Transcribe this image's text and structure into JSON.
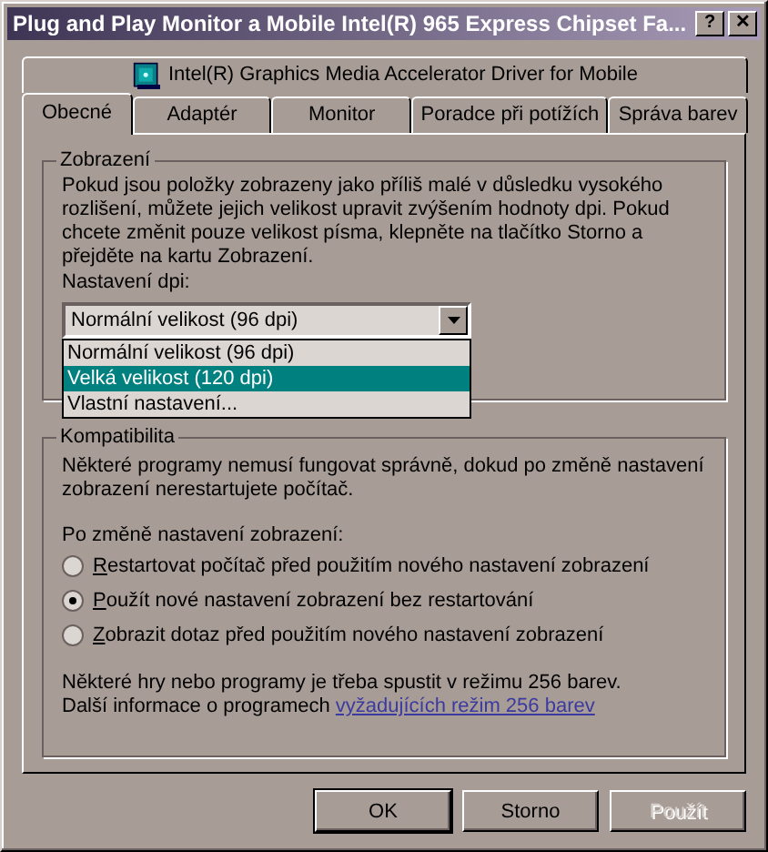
{
  "window": {
    "title": "Plug and Play Monitor a Mobile Intel(R) 965 Express Chipset Fa...",
    "help": "?",
    "close": "✕"
  },
  "top_tab": {
    "label": "Intel(R) Graphics Media Accelerator Driver for Mobile",
    "selected": false
  },
  "tabs": [
    {
      "label": "Obecné",
      "selected": true
    },
    {
      "label": "Adaptér",
      "selected": false
    },
    {
      "label": "Monitor",
      "selected": false
    },
    {
      "label": "Poradce při potížích",
      "selected": false
    },
    {
      "label": "Správa barev",
      "selected": false
    }
  ],
  "display_group": {
    "title": "Zobrazení",
    "text": "Pokud jsou položky zobrazeny jako příliš malé v důsledku vysokého rozlišení, můžete jejich velikost upravit zvýšením hodnoty dpi. Pokud chcete změnit pouze velikost písma, klepněte na tlačítko Storno a přejděte na kartu Zobrazení.",
    "dpi_label": "Nastavení dpi:",
    "dpi_value": "Normální velikost (96 dpi)",
    "dpi_options": [
      {
        "label": "Normální velikost (96 dpi)",
        "selected": false
      },
      {
        "label": "Velká velikost (120 dpi)",
        "selected": true
      },
      {
        "label": "Vlastní nastavení...",
        "selected": false
      }
    ]
  },
  "compat_group": {
    "title": "Kompatibilita",
    "text": "Některé programy nemusí fungovat správně, dokud po změně nastavení zobrazení nerestartujete počítač.",
    "prompt": "Po změně nastavení zobrazení:",
    "options": [
      {
        "label": "Restartovat počítač před použitím nového nastavení zobrazení",
        "selected": false
      },
      {
        "label": "Použít nové nastavení zobrazení bez restartování",
        "selected": true
      },
      {
        "label": "Zobrazit dotaz před použitím nového nastavení zobrazení",
        "selected": false
      }
    ],
    "note": "Některé hry nebo programy je třeba spustit v režimu 256 barev.",
    "more_text": "Další informace o programech",
    "more_link": "vyžadujících režim 256 barev"
  },
  "buttons": [
    {
      "label": "OK",
      "disabled": false,
      "default": true
    },
    {
      "label": "Storno",
      "disabled": false,
      "default": false
    },
    {
      "label": "Použít",
      "disabled": true,
      "default": false
    }
  ]
}
